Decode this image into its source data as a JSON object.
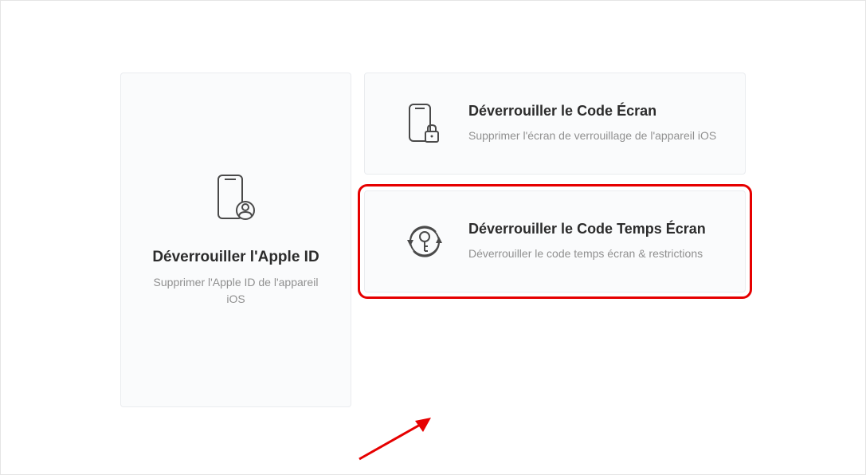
{
  "cards": {
    "apple_id": {
      "title": "Déverrouiller l'Apple ID",
      "subtitle": "Supprimer l'Apple ID de l'appareil iOS"
    },
    "screen_code": {
      "title": "Déverrouiller le Code Écran",
      "subtitle": "Supprimer l'écran de verrouillage de l'appareil iOS"
    },
    "screen_time": {
      "title": "Déverrouiller le Code Temps Écran",
      "subtitle": "Déverrouiller le code temps écran & restrictions"
    }
  }
}
